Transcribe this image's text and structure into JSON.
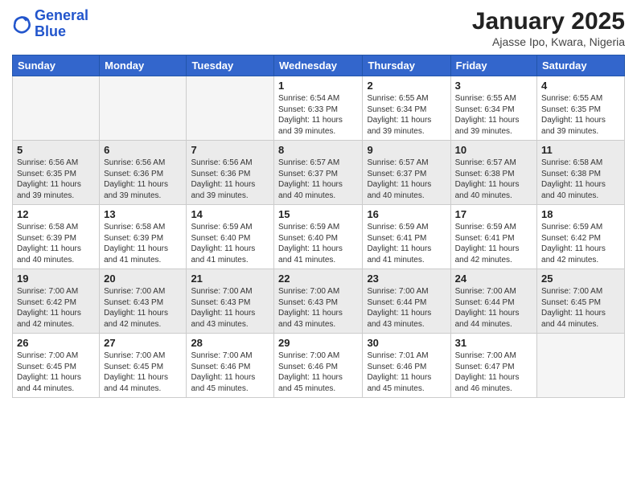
{
  "header": {
    "logo_line1": "General",
    "logo_line2": "Blue",
    "month_title": "January 2025",
    "location": "Ajasse Ipo, Kwara, Nigeria"
  },
  "weekdays": [
    "Sunday",
    "Monday",
    "Tuesday",
    "Wednesday",
    "Thursday",
    "Friday",
    "Saturday"
  ],
  "weeks": [
    [
      {
        "day": "",
        "info": ""
      },
      {
        "day": "",
        "info": ""
      },
      {
        "day": "",
        "info": ""
      },
      {
        "day": "1",
        "info": "Sunrise: 6:54 AM\nSunset: 6:33 PM\nDaylight: 11 hours\nand 39 minutes."
      },
      {
        "day": "2",
        "info": "Sunrise: 6:55 AM\nSunset: 6:34 PM\nDaylight: 11 hours\nand 39 minutes."
      },
      {
        "day": "3",
        "info": "Sunrise: 6:55 AM\nSunset: 6:34 PM\nDaylight: 11 hours\nand 39 minutes."
      },
      {
        "day": "4",
        "info": "Sunrise: 6:55 AM\nSunset: 6:35 PM\nDaylight: 11 hours\nand 39 minutes."
      }
    ],
    [
      {
        "day": "5",
        "info": "Sunrise: 6:56 AM\nSunset: 6:35 PM\nDaylight: 11 hours\nand 39 minutes."
      },
      {
        "day": "6",
        "info": "Sunrise: 6:56 AM\nSunset: 6:36 PM\nDaylight: 11 hours\nand 39 minutes."
      },
      {
        "day": "7",
        "info": "Sunrise: 6:56 AM\nSunset: 6:36 PM\nDaylight: 11 hours\nand 39 minutes."
      },
      {
        "day": "8",
        "info": "Sunrise: 6:57 AM\nSunset: 6:37 PM\nDaylight: 11 hours\nand 40 minutes."
      },
      {
        "day": "9",
        "info": "Sunrise: 6:57 AM\nSunset: 6:37 PM\nDaylight: 11 hours\nand 40 minutes."
      },
      {
        "day": "10",
        "info": "Sunrise: 6:57 AM\nSunset: 6:38 PM\nDaylight: 11 hours\nand 40 minutes."
      },
      {
        "day": "11",
        "info": "Sunrise: 6:58 AM\nSunset: 6:38 PM\nDaylight: 11 hours\nand 40 minutes."
      }
    ],
    [
      {
        "day": "12",
        "info": "Sunrise: 6:58 AM\nSunset: 6:39 PM\nDaylight: 11 hours\nand 40 minutes."
      },
      {
        "day": "13",
        "info": "Sunrise: 6:58 AM\nSunset: 6:39 PM\nDaylight: 11 hours\nand 41 minutes."
      },
      {
        "day": "14",
        "info": "Sunrise: 6:59 AM\nSunset: 6:40 PM\nDaylight: 11 hours\nand 41 minutes."
      },
      {
        "day": "15",
        "info": "Sunrise: 6:59 AM\nSunset: 6:40 PM\nDaylight: 11 hours\nand 41 minutes."
      },
      {
        "day": "16",
        "info": "Sunrise: 6:59 AM\nSunset: 6:41 PM\nDaylight: 11 hours\nand 41 minutes."
      },
      {
        "day": "17",
        "info": "Sunrise: 6:59 AM\nSunset: 6:41 PM\nDaylight: 11 hours\nand 42 minutes."
      },
      {
        "day": "18",
        "info": "Sunrise: 6:59 AM\nSunset: 6:42 PM\nDaylight: 11 hours\nand 42 minutes."
      }
    ],
    [
      {
        "day": "19",
        "info": "Sunrise: 7:00 AM\nSunset: 6:42 PM\nDaylight: 11 hours\nand 42 minutes."
      },
      {
        "day": "20",
        "info": "Sunrise: 7:00 AM\nSunset: 6:43 PM\nDaylight: 11 hours\nand 42 minutes."
      },
      {
        "day": "21",
        "info": "Sunrise: 7:00 AM\nSunset: 6:43 PM\nDaylight: 11 hours\nand 43 minutes."
      },
      {
        "day": "22",
        "info": "Sunrise: 7:00 AM\nSunset: 6:43 PM\nDaylight: 11 hours\nand 43 minutes."
      },
      {
        "day": "23",
        "info": "Sunrise: 7:00 AM\nSunset: 6:44 PM\nDaylight: 11 hours\nand 43 minutes."
      },
      {
        "day": "24",
        "info": "Sunrise: 7:00 AM\nSunset: 6:44 PM\nDaylight: 11 hours\nand 44 minutes."
      },
      {
        "day": "25",
        "info": "Sunrise: 7:00 AM\nSunset: 6:45 PM\nDaylight: 11 hours\nand 44 minutes."
      }
    ],
    [
      {
        "day": "26",
        "info": "Sunrise: 7:00 AM\nSunset: 6:45 PM\nDaylight: 11 hours\nand 44 minutes."
      },
      {
        "day": "27",
        "info": "Sunrise: 7:00 AM\nSunset: 6:45 PM\nDaylight: 11 hours\nand 44 minutes."
      },
      {
        "day": "28",
        "info": "Sunrise: 7:00 AM\nSunset: 6:46 PM\nDaylight: 11 hours\nand 45 minutes."
      },
      {
        "day": "29",
        "info": "Sunrise: 7:00 AM\nSunset: 6:46 PM\nDaylight: 11 hours\nand 45 minutes."
      },
      {
        "day": "30",
        "info": "Sunrise: 7:01 AM\nSunset: 6:46 PM\nDaylight: 11 hours\nand 45 minutes."
      },
      {
        "day": "31",
        "info": "Sunrise: 7:00 AM\nSunset: 6:47 PM\nDaylight: 11 hours\nand 46 minutes."
      },
      {
        "day": "",
        "info": ""
      }
    ]
  ]
}
